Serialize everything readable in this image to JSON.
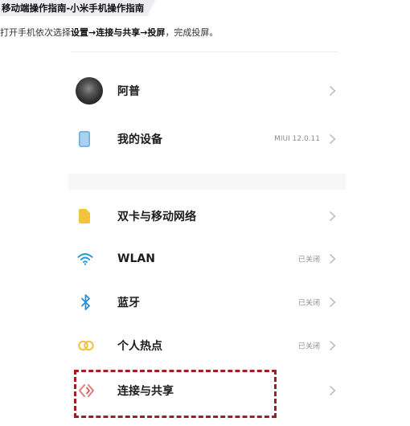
{
  "header": {
    "tag": "移动端操作指南-小米手机操作指南",
    "instruction_prefix": "打开手机依次选择",
    "instruction_path": "设置→连接与共享→投屏",
    "instruction_suffix": "，完成投屏。"
  },
  "settings": {
    "account": {
      "name": "阿普",
      "icon": "avatar"
    },
    "device": {
      "label": "我的设备",
      "value": "MIUI 12.0.11",
      "icon": "phone-icon"
    },
    "items": [
      {
        "label": "双卡与移动网络",
        "value": "",
        "icon": "sim-card-icon"
      },
      {
        "label": "WLAN",
        "value": "已关闭",
        "icon": "wifi-icon"
      },
      {
        "label": "蓝牙",
        "value": "已关闭",
        "icon": "bluetooth-icon"
      },
      {
        "label": "个人热点",
        "value": "已关闭",
        "icon": "hotspot-icon"
      },
      {
        "label": "连接与共享",
        "value": "",
        "icon": "connection-share-icon"
      }
    ]
  },
  "colors": {
    "highlight_border": "#a11f22",
    "wifi_icon": "#2f9bd6",
    "bluetooth_icon": "#2f8fd6",
    "sim_icon": "#f3c338",
    "hotspot_icon": "#f0c23a",
    "device_icon": "#5aa7dc"
  }
}
